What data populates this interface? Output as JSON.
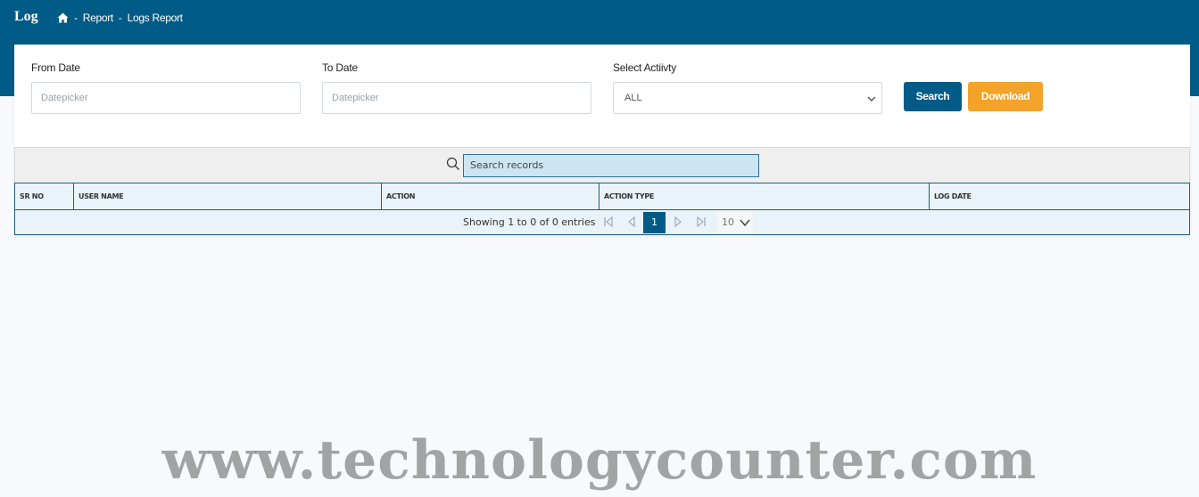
{
  "header": {
    "title": "Log",
    "breadcrumb": {
      "home_icon": "home-icon",
      "separator": "-",
      "items": [
        "Report",
        "Logs Report"
      ]
    }
  },
  "filters": {
    "from_date": {
      "label": "From Date",
      "placeholder": "Datepicker",
      "value": ""
    },
    "to_date": {
      "label": "To Date",
      "placeholder": "Datepicker",
      "value": ""
    },
    "activity": {
      "label": "Select Actiivty",
      "selected": "ALL"
    },
    "search_label": "Search",
    "download_label": "Download"
  },
  "grid": {
    "search_placeholder": "Search records",
    "columns": [
      "SR NO",
      "USER NAME",
      "ACTION",
      "ACTION TYPE",
      "LOG DATE"
    ],
    "rows": [],
    "pager": {
      "info": "Showing 1 to 0 of 0 entries",
      "current_page": "1",
      "page_size": "10"
    }
  },
  "watermark": "www.technologycounter.com",
  "colors": {
    "primary": "#005b86",
    "accent": "#f3a32a",
    "grid_header": "#eaf3fa"
  }
}
